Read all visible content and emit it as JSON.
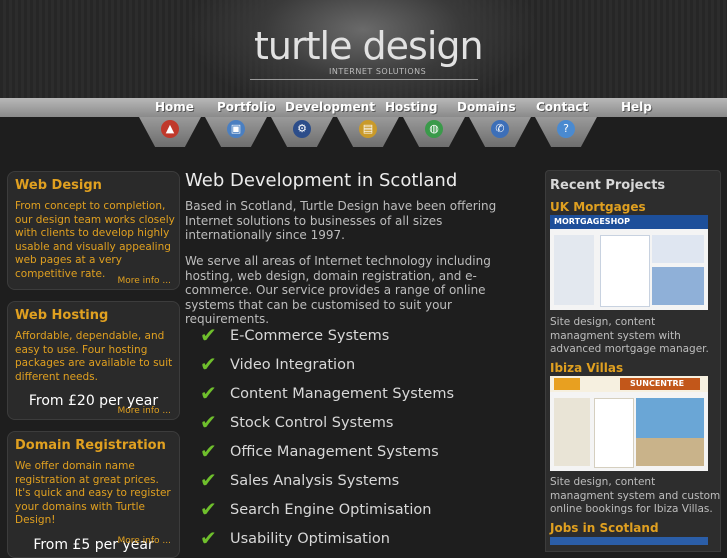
{
  "header": {
    "logo_text": "turtle design",
    "tagline": "INTERNET SOLUTIONS"
  },
  "nav": {
    "items": [
      {
        "label": "Home",
        "icon": "home-icon"
      },
      {
        "label": "Portfolio",
        "icon": "portfolio-icon"
      },
      {
        "label": "Development",
        "icon": "development-icon"
      },
      {
        "label": "Hosting",
        "icon": "hosting-icon"
      },
      {
        "label": "Domains",
        "icon": "domains-icon"
      },
      {
        "label": "Contact",
        "icon": "contact-icon"
      },
      {
        "label": "Help",
        "icon": "help-icon"
      }
    ]
  },
  "sidebar": {
    "web_design": {
      "title": "Web Design",
      "text": "From concept to completion, our design team works closely with clients to develop highly usable and visually appealing web pages at a very competitive rate.",
      "more": "More info ..."
    },
    "web_hosting": {
      "title": "Web Hosting",
      "text": "Affordable, dependable, and easy to use. Four hosting packages are available to suit different needs.",
      "price": "From £20 per year",
      "more": "More info ..."
    },
    "domain_registration": {
      "title": "Domain Registration",
      "text": "We offer domain name registration at great prices. It's quick and easy to register your domains with Turtle Design!",
      "price": "From £5 per year",
      "more": "More info ..."
    }
  },
  "main": {
    "title": "Web Development in Scotland",
    "para1": "Based in Scotland, Turtle Design have been offering Internet solutions to businesses of all sizes internationally since 1997.",
    "para2": "We serve all areas of Internet technology including hosting, web design, domain registration, and e-commerce. Our service provides a range of online systems that can be customised to suit your requirements.",
    "services": [
      "E-Commerce Systems",
      "Video Integration",
      "Content Management Systems",
      "Stock Control Systems",
      "Office Management Systems",
      "Sales Analysis Systems",
      "Search Engine Optimisation",
      "Usability Optimisation"
    ]
  },
  "recent": {
    "title": "Recent Projects",
    "projects": [
      {
        "name": "UK Mortgages",
        "shot_brand": "MORTGAGESHOP",
        "desc": "Site design, content managment system with advanced mortgage manager."
      },
      {
        "name": "Ibiza Villas",
        "shot_brand": "SUNCENTRE",
        "desc": "Site design, content managment system and custom online bookings for Ibiza Villas."
      },
      {
        "name": "Jobs in Scotland"
      }
    ]
  },
  "colors": {
    "accent": "#e0a020",
    "check": "#6fbf2c",
    "background": "#1e1e1e"
  }
}
